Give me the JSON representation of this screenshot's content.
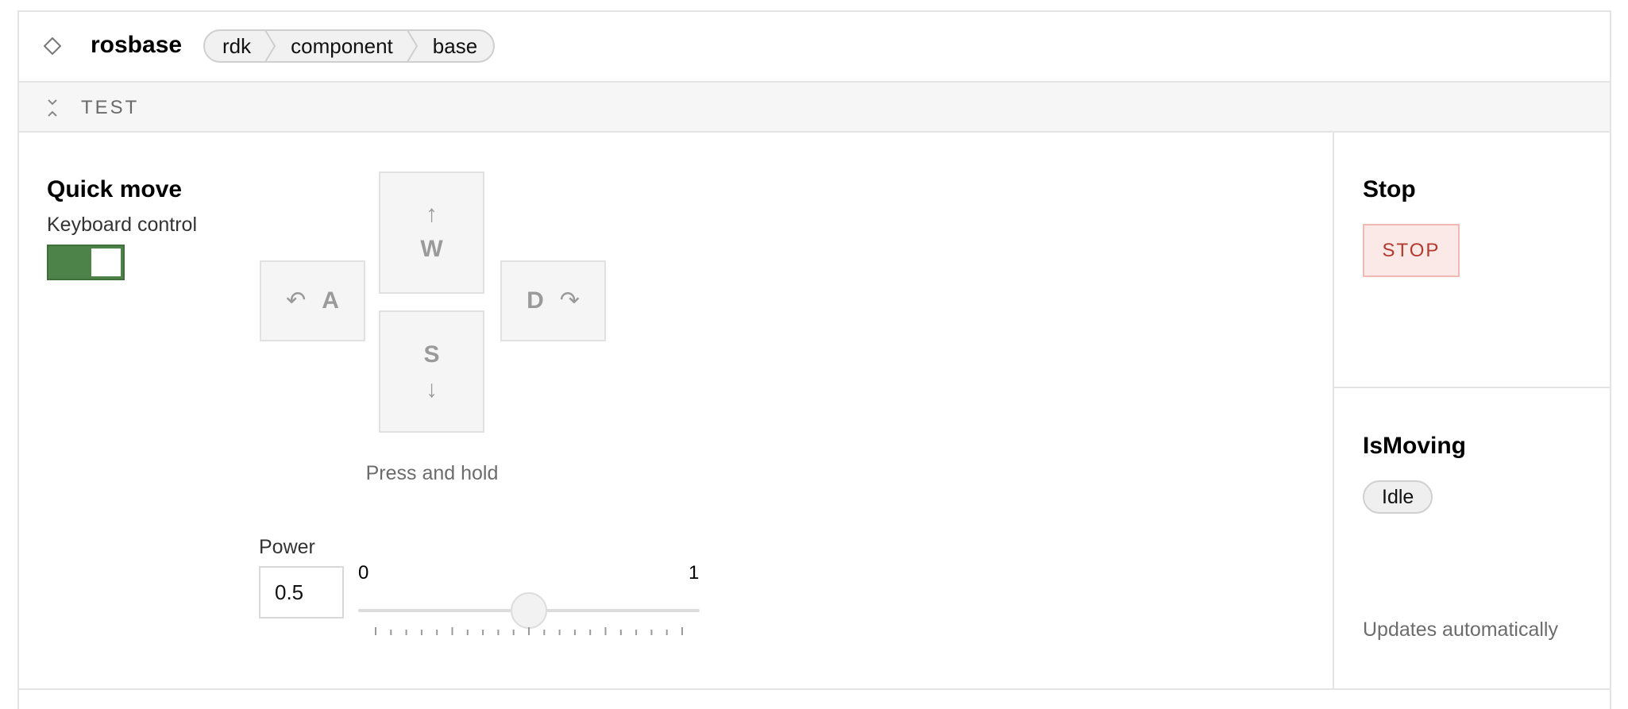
{
  "header": {
    "title": "rosbase",
    "breadcrumbs": [
      "rdk",
      "component",
      "base"
    ]
  },
  "section": {
    "title": "TEST"
  },
  "quick_move": {
    "heading": "Quick move",
    "keyboard_label": "Keyboard control",
    "keyboard_enabled": true,
    "keys": {
      "w": {
        "letter": "W",
        "glyph": "↑"
      },
      "a": {
        "letter": "A",
        "glyph": "↶"
      },
      "s": {
        "letter": "S",
        "glyph": "↓"
      },
      "d": {
        "letter": "D",
        "glyph": "↷"
      }
    },
    "hint": "Press and hold",
    "power": {
      "label": "Power",
      "value": "0.5",
      "min_label": "0",
      "max_label": "1"
    }
  },
  "stop": {
    "heading": "Stop",
    "button_label": "STOP"
  },
  "is_moving": {
    "heading": "IsMoving",
    "status": "Idle",
    "note": "Updates automatically"
  },
  "colors": {
    "toggle_on": "#4d8248",
    "stop_text": "#b33a2f",
    "stop_bg": "#fbe9e7",
    "border": "#e4e4e4"
  }
}
